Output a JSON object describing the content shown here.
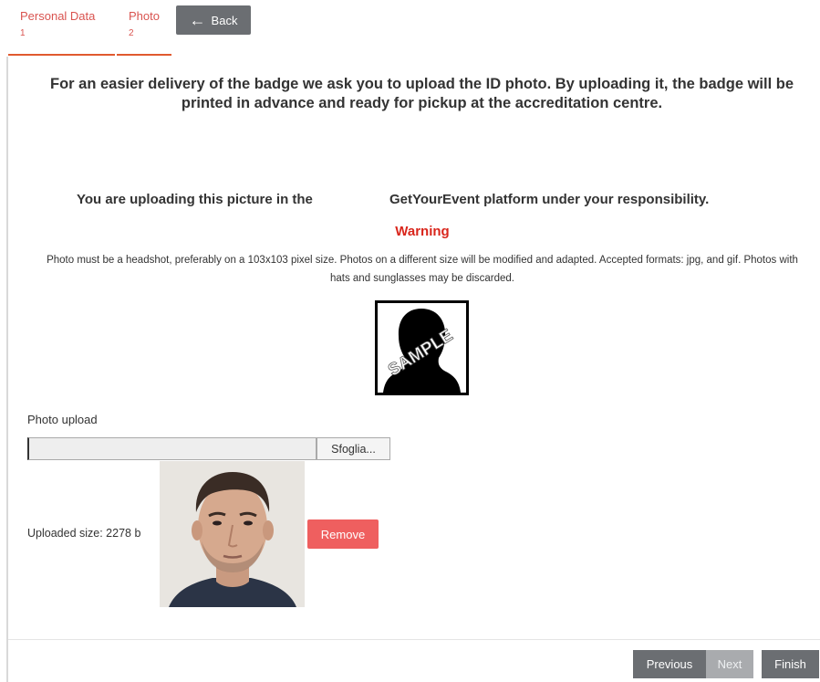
{
  "tabs": [
    {
      "label": "Personal Data",
      "number": "1"
    },
    {
      "label": "Photo",
      "number": "2"
    }
  ],
  "back_label": "Back",
  "intro_text": "For an easier delivery of the badge we ask you to upload the ID photo. By uploading it, the badge will be printed in advance and ready for pickup at the accreditation centre.",
  "responsibility": {
    "part1": "You are uploading this picture in the",
    "part2": "GetYourEvent platform under your responsibility."
  },
  "warning": {
    "title": "Warning",
    "text": "Photo must be a headshot, preferably on a 103x103 pixel size. Photos on a different size will be modified and adapted. Accepted formats: jpg, and gif. Photos with hats and sunglasses may be discarded."
  },
  "sample_watermark": "SAMPLE",
  "upload": {
    "label": "Photo upload",
    "file_value": "",
    "browse_label": "Sfoglia...",
    "uploaded_size": "Uploaded size: 2278 b",
    "remove_label": "Remove"
  },
  "nav": {
    "previous_label": "Previous",
    "next_label": "Next",
    "finish_label": "Finish"
  },
  "colors": {
    "accent": "#d9534f",
    "warning": "#d9261c",
    "button_dark": "#6b6e72",
    "remove": "#ef5f5f"
  }
}
